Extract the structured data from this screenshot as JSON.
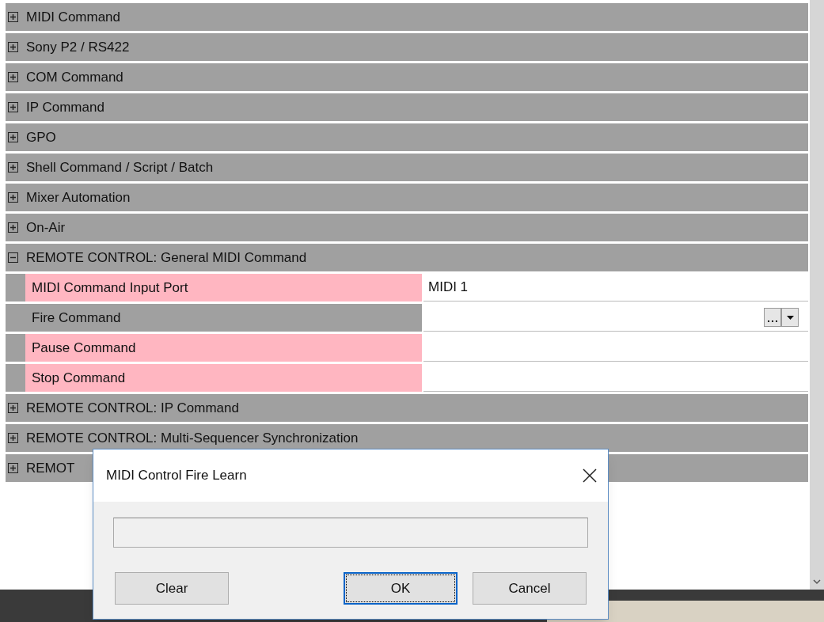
{
  "categories": [
    {
      "label": "MIDI Command",
      "expanded": false
    },
    {
      "label": "Sony P2 / RS422",
      "expanded": false
    },
    {
      "label": "COM Command",
      "expanded": false
    },
    {
      "label": "IP Command",
      "expanded": false
    },
    {
      "label": "GPO",
      "expanded": false
    },
    {
      "label": "Shell Command / Script / Batch",
      "expanded": false
    },
    {
      "label": "Mixer Automation",
      "expanded": false
    },
    {
      "label": "On-Air",
      "expanded": false
    },
    {
      "label": "REMOTE CONTROL: General MIDI Command",
      "expanded": true,
      "properties": [
        {
          "name": "MIDI Command Input Port",
          "value": "MIDI 1",
          "highlighted": true,
          "kind": "text"
        },
        {
          "name": "Fire Command",
          "highlighted": false,
          "kind": "picker"
        },
        {
          "name": "Pause Command",
          "highlighted": true,
          "kind": "text"
        },
        {
          "name": "Stop Command",
          "highlighted": true,
          "kind": "text"
        }
      ]
    },
    {
      "label": "REMOTE CONTROL: IP Command",
      "expanded": false
    },
    {
      "label": "REMOTE CONTROL: Multi-Sequencer Synchronization",
      "expanded": false
    },
    {
      "label": "REMOT",
      "expanded": false
    }
  ],
  "dialog": {
    "title": "MIDI Control Fire Learn",
    "buttons": [
      {
        "label": "Clear",
        "focused": false
      },
      {
        "label": "OK",
        "focused": true
      },
      {
        "label": "Cancel",
        "focused": false
      }
    ]
  }
}
